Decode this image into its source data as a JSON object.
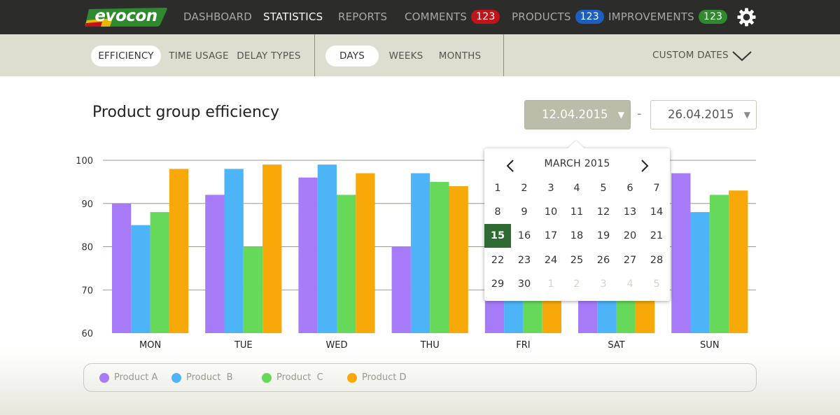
{
  "app": {
    "logo_text": "evocon"
  },
  "nav": {
    "items": [
      {
        "label": "DASHBOARD",
        "active": false
      },
      {
        "label": "STATISTICS",
        "active": true
      },
      {
        "label": "REPORTS",
        "active": false
      },
      {
        "label": "COMMENTS",
        "active": false,
        "badge": "123",
        "badge_color": "#c0141a"
      },
      {
        "label": "PRODUCTS",
        "active": false,
        "badge": "123",
        "badge_color": "#1c5fc0"
      },
      {
        "label": "IMPROVEMENTS",
        "active": false,
        "badge": "123",
        "badge_color": "#2f8a2f"
      }
    ],
    "settings_icon": "gear-icon"
  },
  "subnav": {
    "metric_tabs": [
      {
        "label": "EFFICIENCY",
        "selected": true
      },
      {
        "label": "TIME USAGE",
        "selected": false
      },
      {
        "label": "DELAY TYPES",
        "selected": false
      }
    ],
    "period_tabs": [
      {
        "label": "DAYS",
        "selected": true
      },
      {
        "label": "WEEKS",
        "selected": false
      },
      {
        "label": "MONTHS",
        "selected": false
      }
    ],
    "custom_dates_label": "CUSTOM DATES"
  },
  "page": {
    "title": "Product group efficiency",
    "date_from": "12.04.2015",
    "date_to": "26.04.2015",
    "date_separator": "-"
  },
  "calendar": {
    "month_label": "MARCH 2015",
    "selected_day": "15",
    "days": [
      "1",
      "2",
      "3",
      "4",
      "5",
      "6",
      "7",
      "8",
      "9",
      "10",
      "11",
      "12",
      "13",
      "14",
      "15",
      "16",
      "17",
      "18",
      "19",
      "20",
      "21",
      "22",
      "23",
      "24",
      "25",
      "26",
      "27",
      "28",
      "29",
      "30",
      "1",
      "2",
      "3",
      "4",
      "5"
    ],
    "muted_from_index": 30
  },
  "chart_data": {
    "type": "bar",
    "title": "Product group efficiency",
    "categories": [
      "MON",
      "TUE",
      "WED",
      "THU",
      "FRI",
      "SAT",
      "SUN"
    ],
    "ylim": [
      60,
      100
    ],
    "yticks": [
      60,
      70,
      80,
      90,
      100
    ],
    "grid": true,
    "legend_position": "bottom",
    "series": [
      {
        "name": "Product A",
        "color": "#a77bf7",
        "values": [
          90,
          92,
          96,
          80,
          78,
          78,
          97
        ]
      },
      {
        "name": "Product  B",
        "color": "#4db4f8",
        "values": [
          85,
          98,
          99,
          97,
          76,
          76,
          88
        ]
      },
      {
        "name": "Product  C",
        "color": "#66d95a",
        "values": [
          88,
          80,
          92,
          95,
          76,
          76,
          92
        ]
      },
      {
        "name": "Product D",
        "color": "#f7a90a",
        "values": [
          98,
          99,
          97,
          94,
          78,
          76,
          93
        ]
      }
    ]
  }
}
